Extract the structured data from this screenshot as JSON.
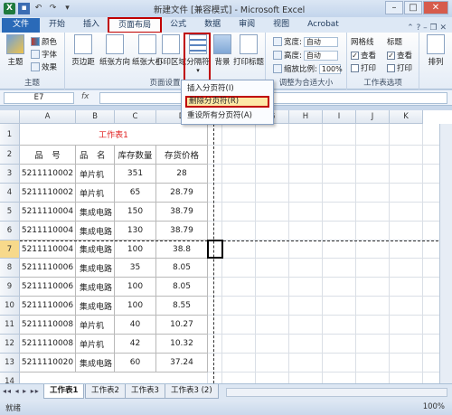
{
  "window": {
    "title": "新建文件 [兼容模式] - Microsoft Excel"
  },
  "tabs": [
    {
      "label": "文件"
    },
    {
      "label": "开始"
    },
    {
      "label": "插入"
    },
    {
      "label": "页面布局"
    },
    {
      "label": "公式"
    },
    {
      "label": "数据"
    },
    {
      "label": "审阅"
    },
    {
      "label": "视图"
    },
    {
      "label": "Acrobat"
    }
  ],
  "ribbon": {
    "theme": {
      "main": "主题",
      "colors": "颜色",
      "fonts": "字体",
      "effects": "效果",
      "group": "主题"
    },
    "page_setup": {
      "margins": "页边距",
      "orientation": "纸张方向",
      "size": "纸张大小",
      "print_area": "打印区域",
      "breaks": "分隔符",
      "background": "背景",
      "print_titles": "打印标题",
      "group": "页面设置"
    },
    "scale": {
      "width_label": "宽度:",
      "width_value": "自动",
      "height_label": "高度:",
      "height_value": "自动",
      "scale_label": "缩放比例:",
      "scale_value": "100%",
      "group": "调整为合适大小"
    },
    "sheet_options": {
      "gridlines": "网格线",
      "headings": "标题",
      "view": "查看",
      "print": "打印",
      "group": "工作表选项"
    },
    "arrange": {
      "label": "排列"
    }
  },
  "breaks_menu": {
    "items": [
      "插入分页符(I)",
      "删除分页符(R)",
      "重设所有分页符(A)"
    ]
  },
  "formula_bar": {
    "name_box": "E7",
    "fx": "fx",
    "value": ""
  },
  "columns": [
    "A",
    "B",
    "C",
    "D",
    "E",
    "F",
    "G",
    "H",
    "I",
    "J",
    "K"
  ],
  "rows": [
    "1",
    "2",
    "3",
    "4",
    "5",
    "6",
    "7",
    "8",
    "9",
    "10",
    "11",
    "12",
    "13",
    "14"
  ],
  "sheet": {
    "title": "工作表1",
    "headers": [
      "品　号",
      "品　名",
      "库存数量",
      "存货价格"
    ],
    "data": [
      [
        "5211110002",
        "单片机",
        "351",
        "28"
      ],
      [
        "5211110002",
        "单片机",
        "65",
        "28.79"
      ],
      [
        "5211110004",
        "集成电路",
        "150",
        "38.79"
      ],
      [
        "5211110004",
        "集成电路",
        "130",
        "38.79"
      ],
      [
        "5211110004",
        "集成电路",
        "100",
        "38.8"
      ],
      [
        "5211110006",
        "集成电路",
        "35",
        "8.05"
      ],
      [
        "5211110006",
        "集成电路",
        "100",
        "8.05"
      ],
      [
        "5211110006",
        "集成电路",
        "100",
        "8.55"
      ],
      [
        "5211110008",
        "单片机",
        "40",
        "10.27"
      ],
      [
        "5211110008",
        "单片机",
        "42",
        "10.32"
      ],
      [
        "5211110020",
        "集成电路",
        "60",
        "37.24"
      ]
    ],
    "title_color": "#e02020"
  },
  "sheet_tabs": [
    "工作表1",
    "工作表2",
    "工作表3",
    "工作表3 (2)"
  ],
  "status": {
    "left": "就绪",
    "zoom": "100%"
  }
}
